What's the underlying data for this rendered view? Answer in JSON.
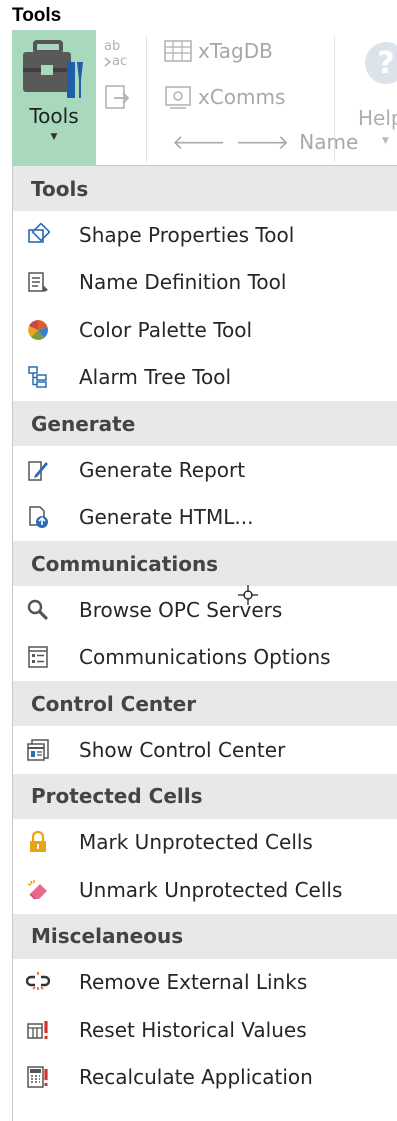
{
  "page": {
    "title": "Tools"
  },
  "ribbon": {
    "tools_button": {
      "label": "Tools",
      "icon": "toolbox-icon"
    },
    "xtagdb_label": "xTagDB",
    "xcomms_label": "xComms",
    "name_label": "Name",
    "help_label": "Help",
    "accent_color": "#a9d9bc"
  },
  "menu": {
    "sections": [
      {
        "header": "Tools",
        "items": [
          {
            "label": "Shape Properties Tool",
            "icon": "shape-properties-icon"
          },
          {
            "label": "Name Definition Tool",
            "icon": "name-definition-icon"
          },
          {
            "label": "Color Palette Tool",
            "icon": "color-palette-icon"
          },
          {
            "label": "Alarm Tree Tool",
            "icon": "alarm-tree-icon"
          }
        ]
      },
      {
        "header": "Generate",
        "items": [
          {
            "label": "Generate Report",
            "icon": "generate-report-icon"
          },
          {
            "label": "Generate HTML...",
            "icon": "generate-html-icon"
          }
        ]
      },
      {
        "header": "Communications",
        "items": [
          {
            "label": "Browse OPC Servers",
            "icon": "search-icon"
          },
          {
            "label": "Communications Options",
            "icon": "options-list-icon"
          }
        ]
      },
      {
        "header": "Control Center",
        "items": [
          {
            "label": "Show Control Center",
            "icon": "control-center-icon"
          }
        ]
      },
      {
        "header": "Protected Cells",
        "items": [
          {
            "label": "Mark Unprotected Cells",
            "icon": "lock-icon"
          },
          {
            "label": "Unmark Unprotected Cells",
            "icon": "eraser-icon"
          }
        ]
      },
      {
        "header": "Miscelaneous",
        "items": [
          {
            "label": "Remove External Links",
            "icon": "broken-link-icon"
          },
          {
            "label": "Reset Historical Values",
            "icon": "reset-table-icon"
          },
          {
            "label": "Recalculate Application",
            "icon": "calculator-icon"
          }
        ]
      }
    ]
  }
}
